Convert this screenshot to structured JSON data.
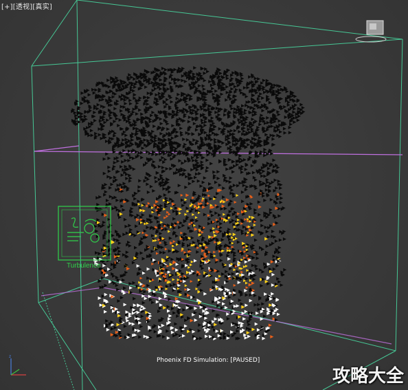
{
  "viewport": {
    "label_parts": [
      "[+]",
      "[透视]",
      "[真实]"
    ],
    "status_text": "Phoenix FD Simulation: [PAUSED]",
    "helper_label": "Turbulence",
    "watermark": "攻略大全"
  },
  "colors": {
    "background": "#3a3a3a",
    "grid_box": "#48d8a0",
    "slice_plane": "#c070e0",
    "helper": "#2fd34a",
    "fire_hot": "#ffd21a",
    "fire_mid": "#e8601a",
    "smoke": "#0a0a0a"
  },
  "icons": [
    "turbulence-helper-icon",
    "camera-icon",
    "axis-gizmo-icon"
  ]
}
